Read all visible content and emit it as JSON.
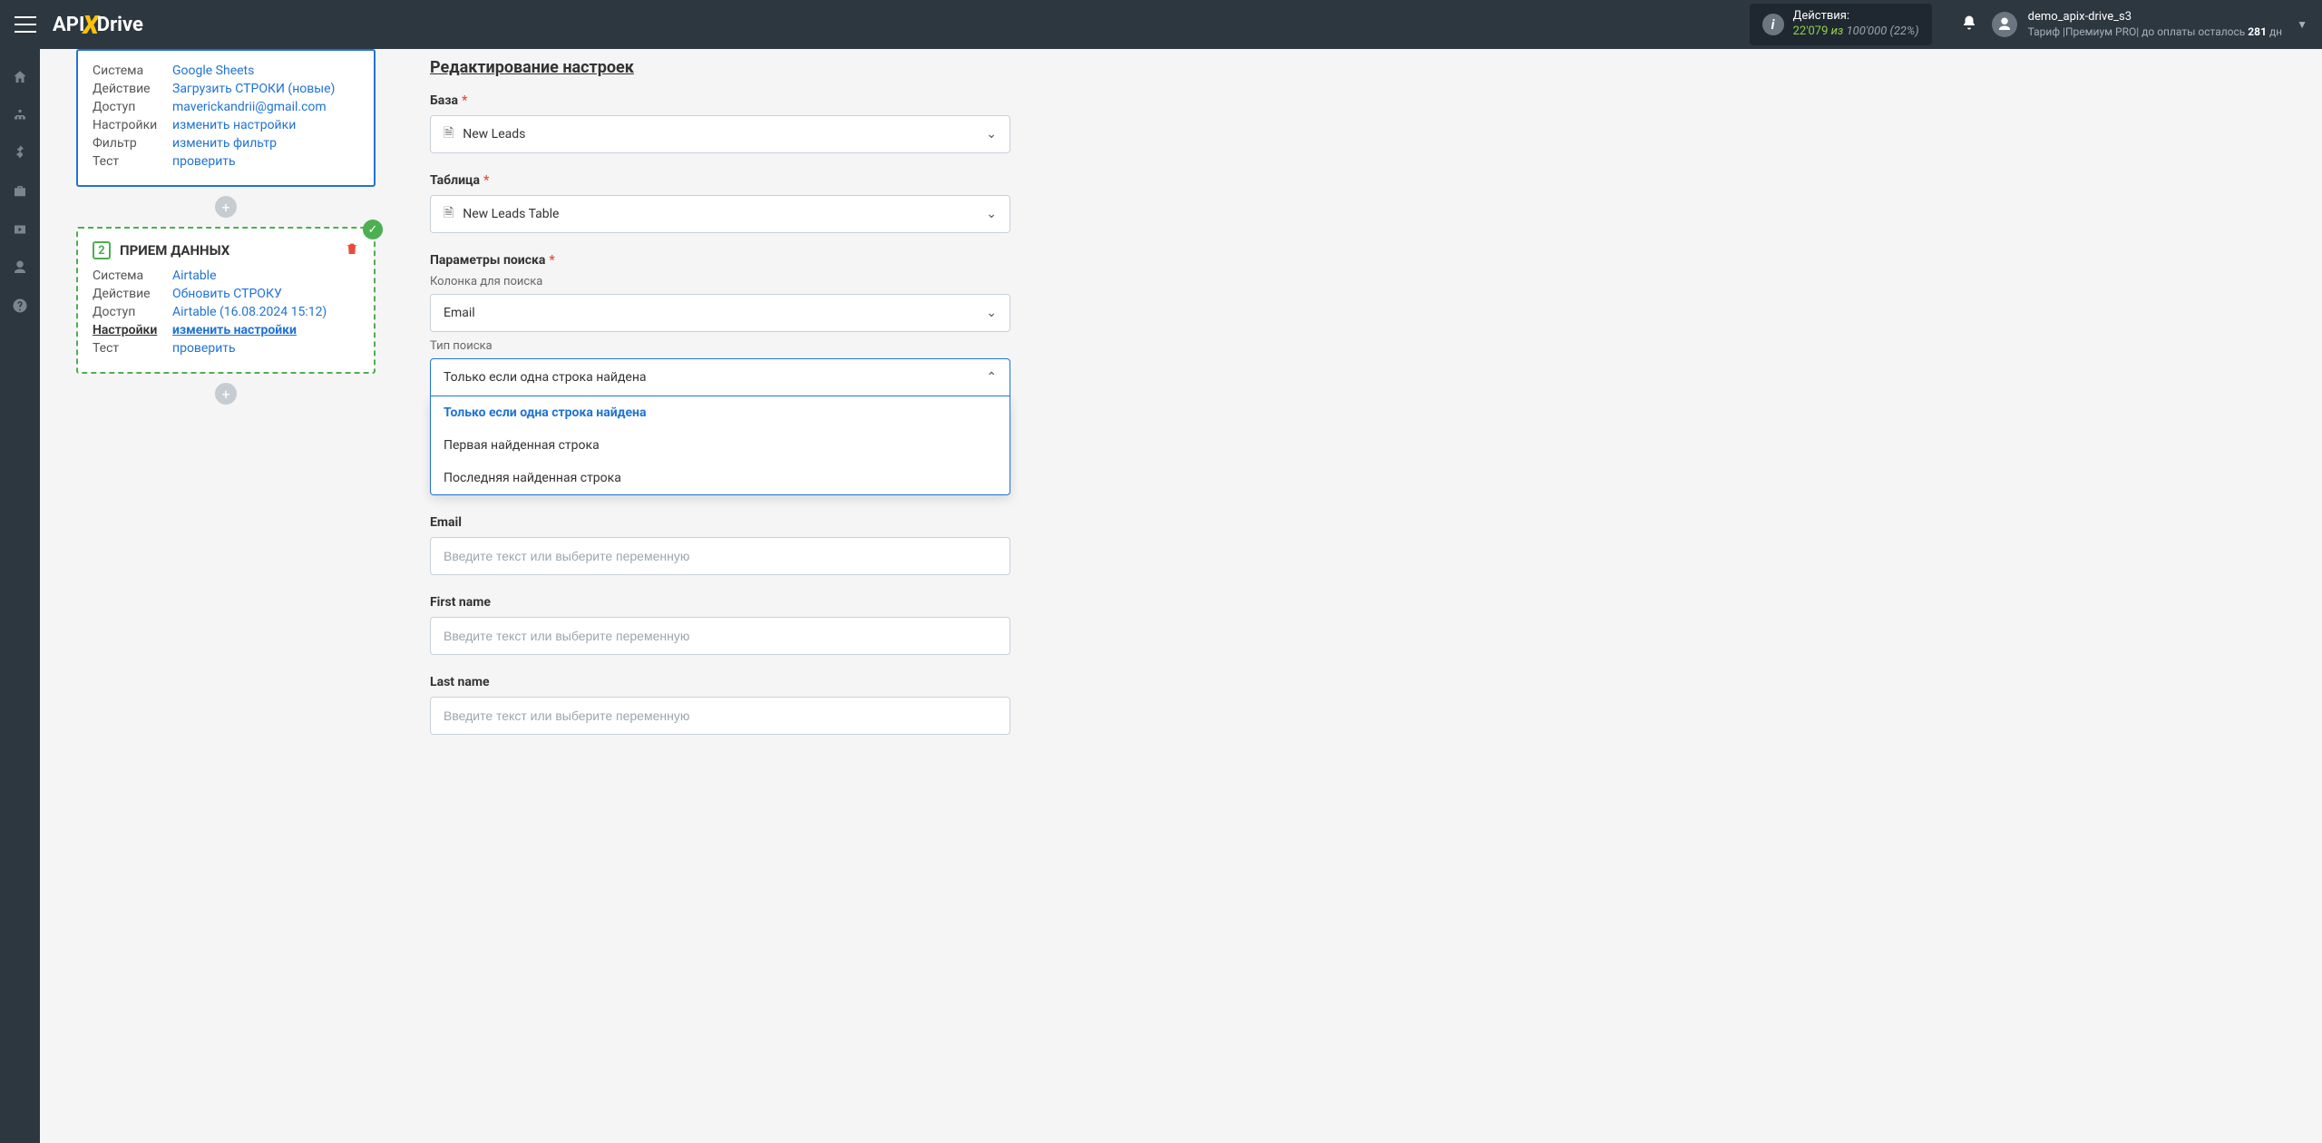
{
  "header": {
    "logo": {
      "part1": "API",
      "part2": "X",
      "part3": "Drive"
    },
    "actions": {
      "label": "Действия:",
      "count": "22'079",
      "iz": "из",
      "limit": "100'000",
      "percent": "(22%)"
    },
    "user": {
      "name": "demo_apix-drive_s3",
      "tariff_prefix": "Тариф |Премиум PRO| до оплаты осталось",
      "days": "281",
      "days_suffix": "дн"
    }
  },
  "left": {
    "card1": {
      "rows": {
        "system": {
          "label": "Система",
          "value": "Google Sheets"
        },
        "action": {
          "label": "Действие",
          "value": "Загрузить СТРОКИ (новые)"
        },
        "access": {
          "label": "Доступ",
          "value": "maverickandrii@gmail.com"
        },
        "settings": {
          "label": "Настройки",
          "value": "изменить настройки"
        },
        "filter": {
          "label": "Фильтр",
          "value": "изменить фильтр"
        },
        "test": {
          "label": "Тест",
          "value": "проверить"
        }
      }
    },
    "card2": {
      "num": "2",
      "title": "ПРИЕМ ДАННЫХ",
      "rows": {
        "system": {
          "label": "Система",
          "value": "Airtable"
        },
        "action": {
          "label": "Действие",
          "value": "Обновить СТРОКУ"
        },
        "access": {
          "label": "Доступ",
          "value": "Airtable (16.08.2024 15:12)"
        },
        "settings": {
          "label": "Настройки",
          "value": "изменить настройки"
        },
        "test": {
          "label": "Тест",
          "value": "проверить"
        }
      }
    }
  },
  "right": {
    "section_title": "Редактирование настроек",
    "base": {
      "label": "База",
      "value": "New Leads"
    },
    "table": {
      "label": "Таблица",
      "value": "New Leads Table"
    },
    "search_params": {
      "label": "Параметры поиска",
      "column_label": "Колонка для поиска",
      "column_value": "Email",
      "type_label": "Тип поиска",
      "type_value": "Только если одна строка найдена",
      "options": [
        "Только если одна строка найдена",
        "Первая найденная строка",
        "Последняя найденная строка"
      ]
    },
    "email": {
      "label": "Email",
      "placeholder": "Введите текст или выберите переменную"
    },
    "first_name": {
      "label": "First name",
      "placeholder": "Введите текст или выберите переменную"
    },
    "last_name": {
      "label": "Last name",
      "placeholder": "Введите текст или выберите переменную"
    }
  }
}
